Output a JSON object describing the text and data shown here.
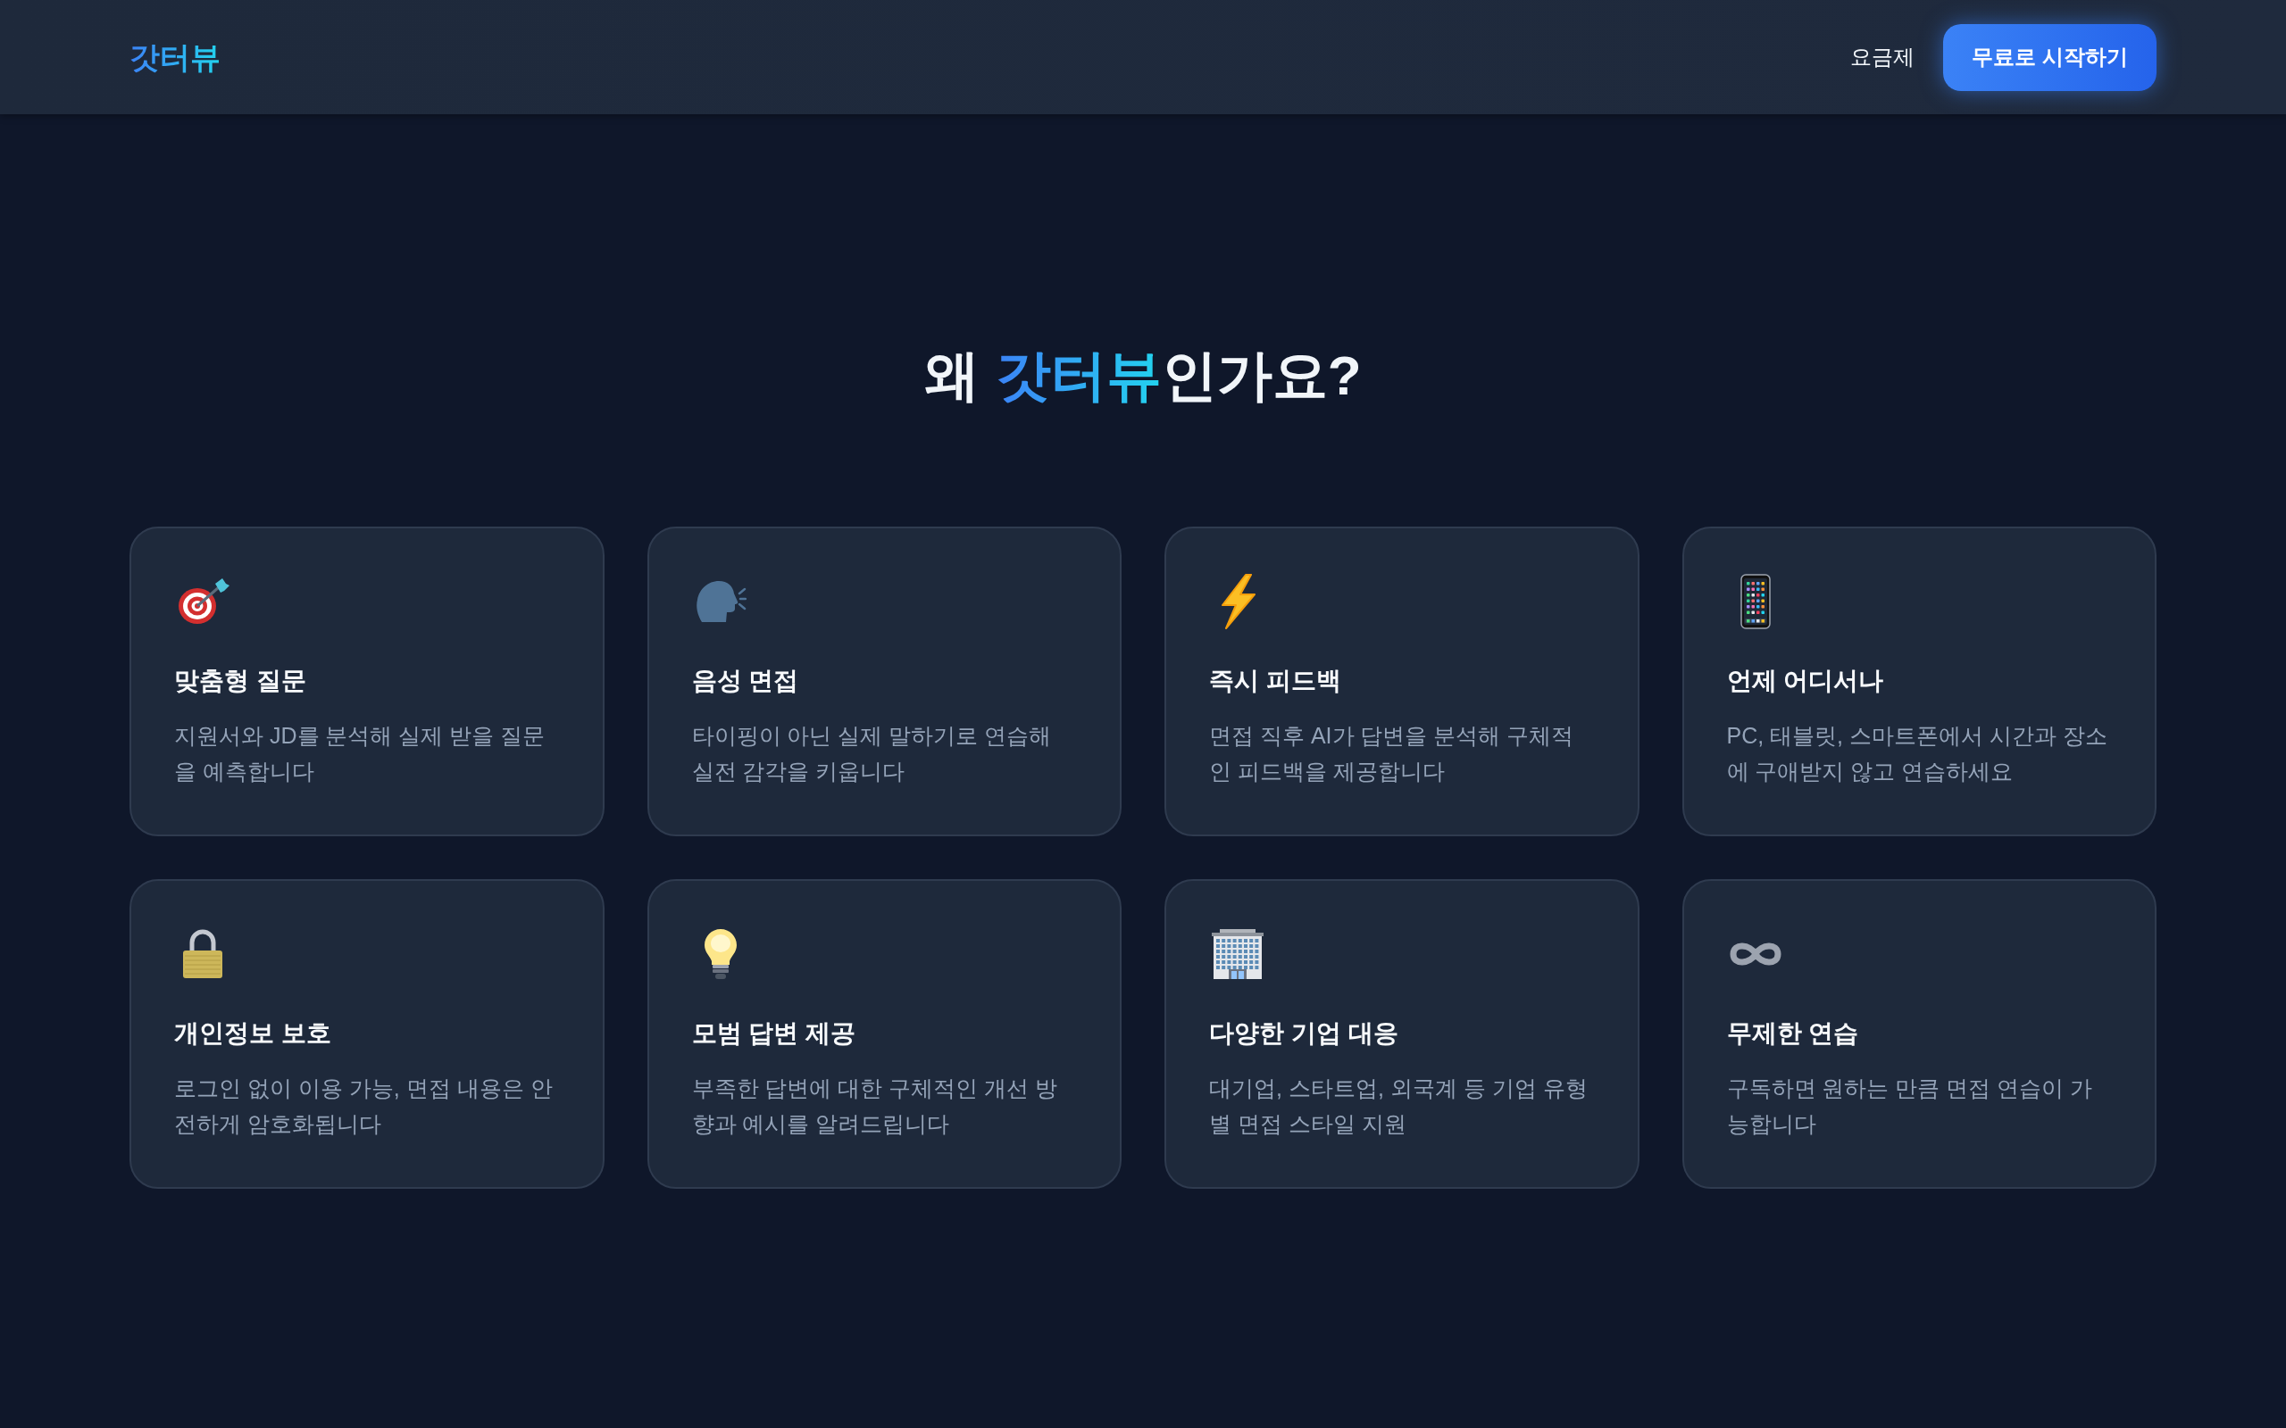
{
  "header": {
    "logo": "갓터뷰",
    "nav_links": [
      {
        "label": "요금제"
      }
    ],
    "cta_button": "무료로 시작하기"
  },
  "heading": {
    "segments": [
      {
        "text": "왜 ",
        "highlight": false
      },
      {
        "text": "갓터뷰",
        "highlight": true
      },
      {
        "text": "인가요?",
        "highlight": false
      }
    ]
  },
  "features": [
    {
      "title": "맞춤형 질문",
      "description": "지원서와 JD를 분석해 실제 받을 질문을 예측합니다"
    },
    {
      "title": "음성 면접",
      "description": "타이핑이 아닌 실제 말하기로 연습해 실전 감각을 키웁니다"
    },
    {
      "title": "즉시 피드백",
      "description": "면접 직후 AI가 답변을 분석해 구체적인 피드백을 제공합니다"
    },
    {
      "title": "언제 어디서나",
      "description": "PC, 태블릿, 스마트폰에서 시간과 장소에 구애받지 않고 연습하세요"
    },
    {
      "title": "개인정보 보호",
      "description": "로그인 없이 이용 가능, 면접 내용은 안전하게 암호화됩니다"
    },
    {
      "title": "모범 답변 제공",
      "description": "부족한 답변에 대한 구체적인 개선 방향과 예시를 알려드립니다"
    },
    {
      "title": "다양한 기업 대응",
      "description": "대기업, 스타트업, 외국계 등 기업 유형별 면접 스타일 지원"
    },
    {
      "title": "무제한 연습",
      "description": "구독하면 원하는 만큼 면접 연습이 가능합니다"
    }
  ]
}
